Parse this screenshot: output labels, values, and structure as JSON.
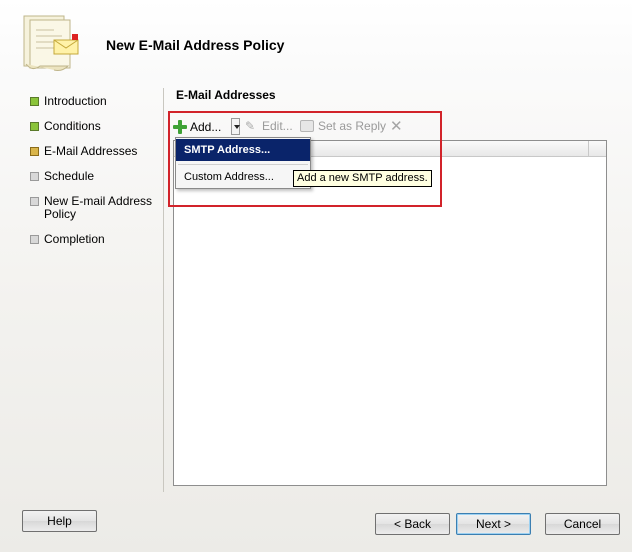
{
  "window": {
    "title": "New E-Mail Address Policy"
  },
  "nav": {
    "items": [
      {
        "label": "Introduction",
        "state": "done"
      },
      {
        "label": "Conditions",
        "state": "done"
      },
      {
        "label": "E-Mail Addresses",
        "state": "current"
      },
      {
        "label": "Schedule",
        "state": "todo"
      },
      {
        "label": "New E-mail Address Policy",
        "state": "todo"
      },
      {
        "label": "Completion",
        "state": "todo"
      }
    ]
  },
  "section": {
    "title": "E-Mail Addresses"
  },
  "toolbar": {
    "add_label": "Add...",
    "edit_label": "Edit...",
    "set_reply_label": "Set as Reply",
    "remove_icon": "x-icon"
  },
  "menu": {
    "items": [
      {
        "label": "SMTP Address...",
        "selected": true
      },
      {
        "label": "Custom Address...",
        "selected": false
      }
    ]
  },
  "tooltip": {
    "text": "Add a new SMTP address."
  },
  "buttons": {
    "help": "Help",
    "back": "< Back",
    "next": "Next >",
    "cancel": "Cancel"
  },
  "colors": {
    "highlight": "#d2232a",
    "menu_selected": "#0a246a",
    "tooltip_bg": "#ffffe1",
    "nav_done": "#8ac43a",
    "nav_current": "#d9b54a"
  }
}
